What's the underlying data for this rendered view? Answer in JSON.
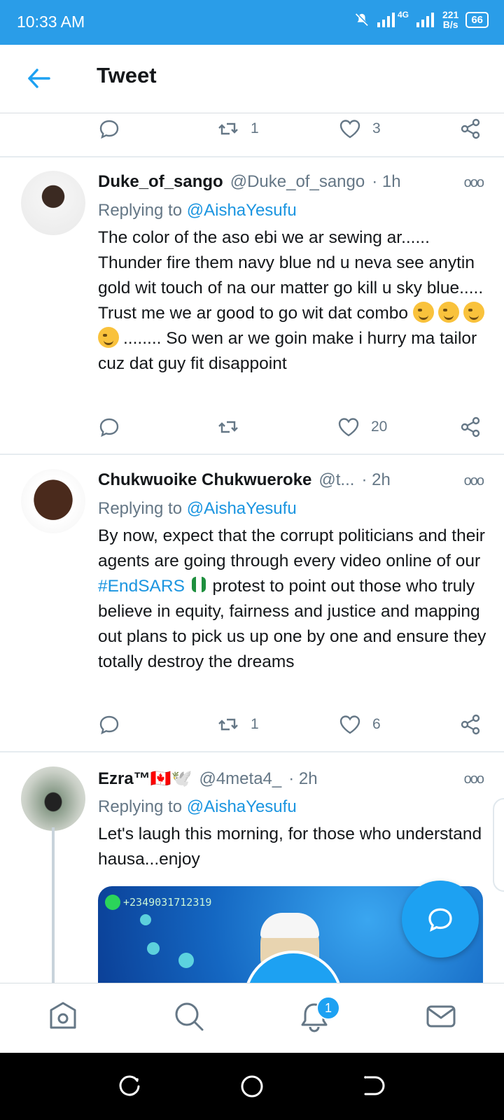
{
  "status_bar": {
    "time": "10:33 AM",
    "network": "4G",
    "speed_value": "221",
    "speed_unit": "B/s",
    "battery": "66"
  },
  "header": {
    "title": "Tweet"
  },
  "top_actions": {
    "retweets": "1",
    "likes": "3"
  },
  "tweets": [
    {
      "name": "Duke_of_sango",
      "handle": "@Duke_of_sango",
      "time": "· 1h",
      "replying_prefix": "Replying to",
      "replying_to": "@AishaYesufu",
      "text_a": "The color of the aso ebi we ar sewing ar...... Thunder fire them navy blue nd u neva see anytin gold wit touch of na our matter go kill u sky blue..... Trust me we ar good to go wit dat combo ",
      "text_b": "........ So wen ar we goin make i hurry ma tailor cuz dat guy fit disappoint",
      "replies": "",
      "retweets": "",
      "likes": "20"
    },
    {
      "name": "Chukwuoike Chukwueroke",
      "handle": "@t...",
      "time": "· 2h",
      "replying_prefix": "Replying to",
      "replying_to": "@AishaYesufu",
      "text_a": "By now, expect that the corrupt politicians and their agents are going through every video online of our ",
      "hashtag": "#EndSARS",
      "text_b": " protest to point out those who truly believe in equity, fairness and justice and mapping out plans to pick us up one by one and ensure they totally destroy the dreams",
      "replies": "",
      "retweets": "1",
      "likes": "6"
    },
    {
      "name": "Ezra™🇨🇦🕊️",
      "handle": "@4meta4_",
      "time": "· 2h",
      "replying_prefix": "Replying to",
      "replying_to": "@AishaYesufu",
      "text_a": "Let's laugh this morning, for those who understand hausa...enjoy",
      "media_watermark": "+2349031712319"
    }
  ],
  "bottom_nav": {
    "notifications_badge": "1"
  },
  "colors": {
    "accent": "#1da1f2",
    "status_bar": "#2a9de8",
    "muted": "#657786",
    "link": "#1b95e0"
  }
}
